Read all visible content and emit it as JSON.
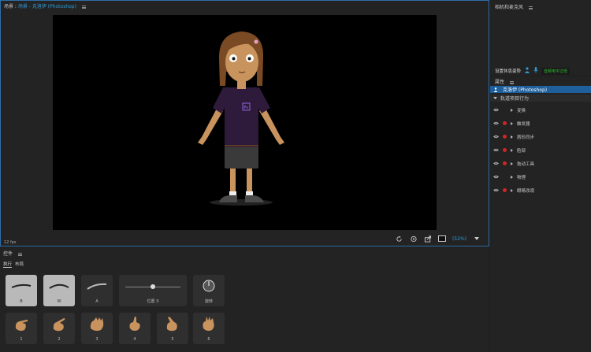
{
  "scene": {
    "label": "场景 : ",
    "breadcrumb_scene": "场景",
    "separator": " - ",
    "puppet_name": "克洛伊 (Photoshop)",
    "fps": "12 fps",
    "zoom": "(52%)"
  },
  "camera": {
    "title": "相机和麦克风",
    "rest_pose_label": "设置休息姿势",
    "calibrate_label": "音频电平过低"
  },
  "properties": {
    "title": "属性",
    "puppet_name": "克洛伊 (Photoshop)",
    "section_label": "轨道项目行为",
    "behaviors": [
      {
        "label": "变换",
        "armed": false
      },
      {
        "label": "触发器",
        "armed": true
      },
      {
        "label": "唇形同步",
        "armed": true
      },
      {
        "label": "脸部",
        "armed": true
      },
      {
        "label": "拖动工具",
        "armed": true
      },
      {
        "label": "物理",
        "armed": false
      },
      {
        "label": "眼睛改观",
        "armed": true
      }
    ]
  },
  "controls": {
    "title": "控件",
    "tab_perform": "执行",
    "tab_layout": "布局",
    "tiles_top": [
      {
        "label": "B",
        "style": "light"
      },
      {
        "label": "W",
        "style": "light"
      },
      {
        "label": "A",
        "style": "dark"
      }
    ],
    "slider_label": "位置 X",
    "slider_value": 0.5,
    "dial_label": "旋转",
    "hand_tiles": [
      "1",
      "2",
      "3",
      "4",
      "5",
      "6"
    ]
  },
  "colors": {
    "accent": "#2f9bd8",
    "selection": "#1e5f9c",
    "armed": "#d12525",
    "level_ok": "#2fbf2f",
    "shirt": "#2e1a3a",
    "skin": "#c9935e",
    "hair": "#7a4a24"
  },
  "icons": [
    "menu-icon",
    "refresh-icon",
    "camera-icon",
    "export-icon",
    "frame-icon",
    "chevron-down-icon",
    "person-icon",
    "mic-icon",
    "eye-icon",
    "hand-icon",
    "dial-icon"
  ]
}
